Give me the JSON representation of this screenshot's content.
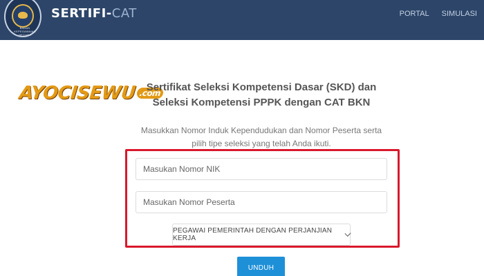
{
  "navbar": {
    "brand_main": "SERTIFI-",
    "brand_accent": "CAT",
    "seal_text": "BADAN KEPEGAWAIAN NEGARA",
    "links": [
      "PORTAL",
      "SIMULASI"
    ]
  },
  "watermark": {
    "text": "AYOCISEWU",
    "domain": ".com"
  },
  "main": {
    "title": "Sertifikat Seleksi Kompetensi Dasar (SKD) dan Seleksi Kompetensi PPPK dengan CAT BKN",
    "description": "Masukkan Nomor Induk Kependudukan dan Nomor Peserta serta pilih tipe seleksi yang telah Anda ikuti."
  },
  "form": {
    "nik_placeholder": "Masukan Nomor NIK",
    "peserta_placeholder": "Masukan Nomor Peserta",
    "selection_type": "PEGAWAI PEMERINTAH DENGAN PERJANJIAN KERJA",
    "submit_label": "UNDUH"
  },
  "colors": {
    "navbar": "#2c4569",
    "highlight": "#d9182b",
    "button": "#1e90d8",
    "watermark": "#e39a15"
  }
}
